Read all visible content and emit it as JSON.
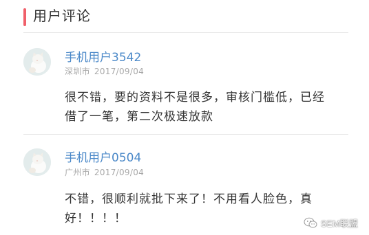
{
  "section": {
    "title": "用户评论",
    "accent_color": "#f0606a"
  },
  "comments": [
    {
      "username": "手机用户3542",
      "city": "深圳市",
      "date": "2017/09/04",
      "text": "很不错，要的资料不是很多，审核门槛低，已经借了一笔，第二次极速放款"
    },
    {
      "username": "手机用户0504",
      "city": "广州市",
      "date": "2017/09/04",
      "text": "不错，很顺利就批下来了！不用看人脸色，真好！！！！"
    }
  ],
  "watermark": {
    "text": "SEM联盟",
    "icon": "wechat-icon"
  }
}
